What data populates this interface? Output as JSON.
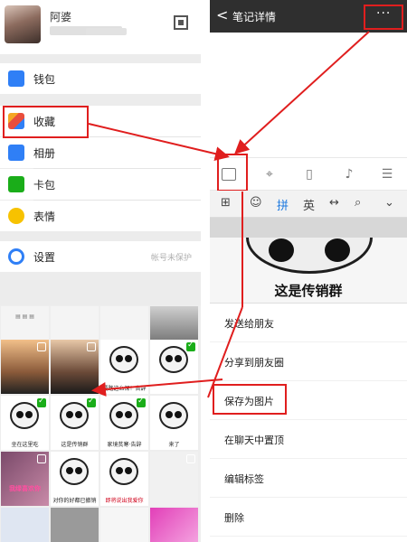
{
  "left": {
    "profile": {
      "name": "阿婆",
      "id_text": "微信号: ********"
    },
    "menu": [
      {
        "label": "钱包",
        "icon": "wallet-icon",
        "color": "#2f7ff6"
      },
      {
        "label": "收藏",
        "icon": "favorites-icon",
        "color": "#f5a623"
      },
      {
        "label": "相册",
        "icon": "album-icon",
        "color": "#2f7ff6"
      },
      {
        "label": "卡包",
        "icon": "card-icon",
        "color": "#1aad19"
      },
      {
        "label": "表情",
        "icon": "emoji-icon",
        "color": "#f7c200"
      },
      {
        "label": "设置",
        "icon": "settings-icon",
        "color": "#2f7ff6",
        "hint": "帐号未保护"
      }
    ],
    "grid_captions": [
      "坐在这里吃",
      "来了",
      "要路这么深！告辞",
      "这是传销群",
      "家境贫寒·告辞",
      "我绿喜欢你",
      "对你的好都已撤销",
      "即将说出我爱你"
    ]
  },
  "right": {
    "title": "笔记详情",
    "back_glyph": "<",
    "more_glyph": "···",
    "ime_keys": [
      "拼",
      "英"
    ],
    "meme_caption": "这是传销群",
    "actions": [
      "发送给朋友",
      "分享到朋友圈",
      "保存为图片",
      "在聊天中置顶",
      "编辑标签",
      "删除"
    ]
  },
  "colors": {
    "highlight": "#e01e1e",
    "accent": "#1f7ae0",
    "wechat_green": "#1aad19",
    "titlebar": "#2f2f2f"
  }
}
